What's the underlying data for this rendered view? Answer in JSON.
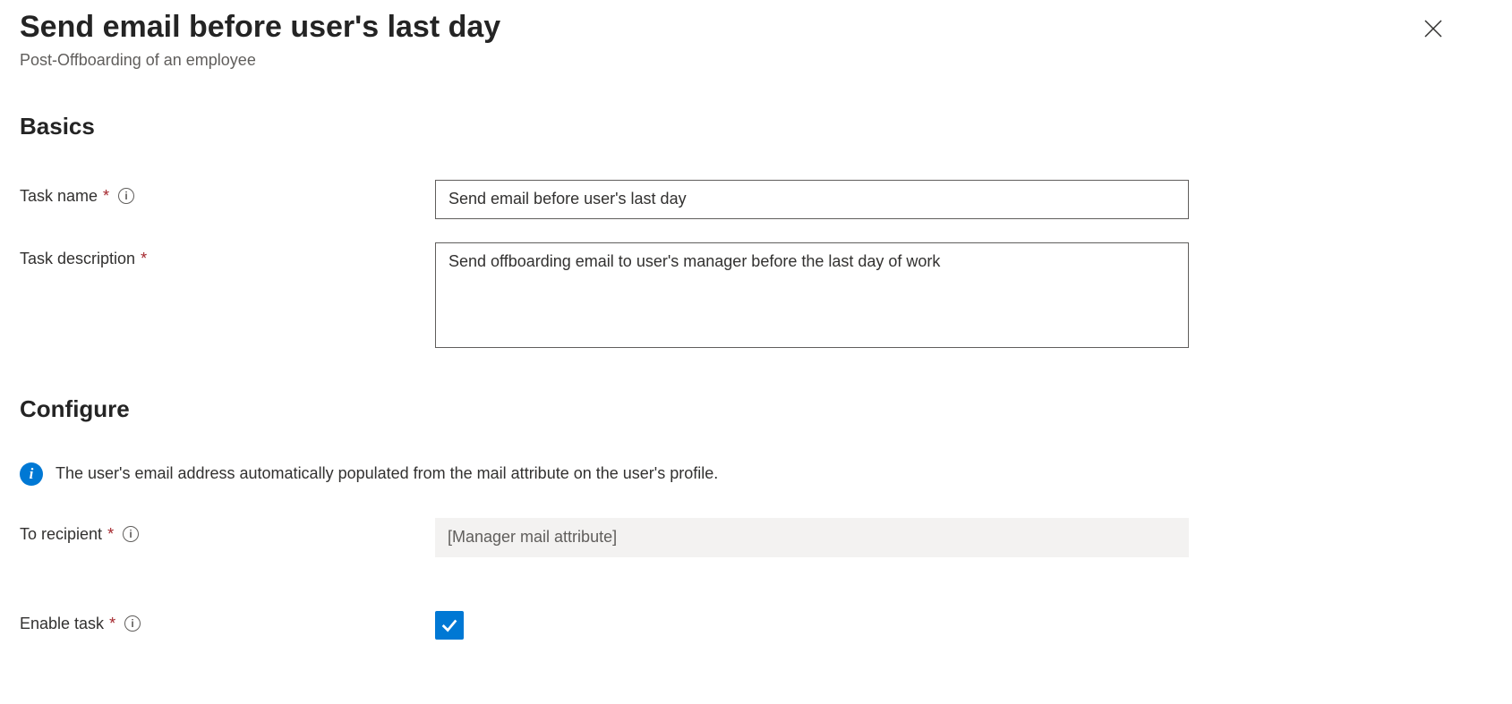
{
  "header": {
    "title": "Send email before user's last day",
    "subtitle": "Post-Offboarding of an employee"
  },
  "sections": {
    "basics": {
      "heading": "Basics"
    },
    "configure": {
      "heading": "Configure",
      "info_text": "The user's email address automatically populated from the mail attribute on the user's profile."
    }
  },
  "fields": {
    "task_name": {
      "label": "Task name",
      "value": "Send email before user's last day"
    },
    "task_description": {
      "label": "Task description",
      "value": "Send offboarding email to user's manager before the last day of work"
    },
    "to_recipient": {
      "label": "To recipient",
      "value": "[Manager mail attribute]"
    },
    "enable_task": {
      "label": "Enable task",
      "checked": true
    }
  }
}
